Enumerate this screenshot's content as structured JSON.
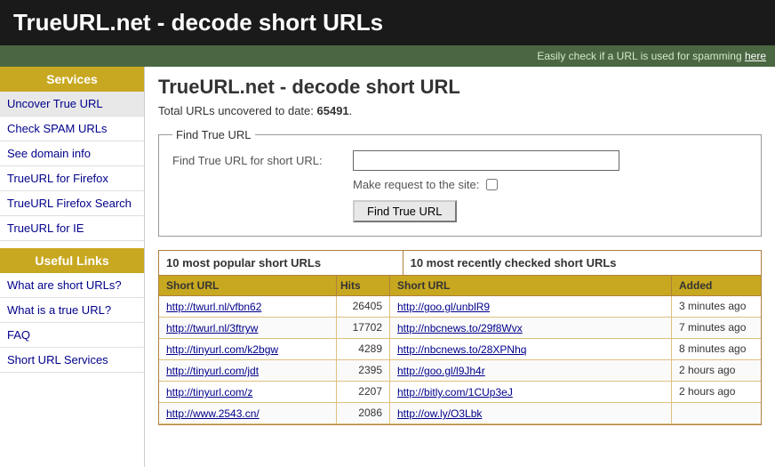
{
  "header": {
    "title": "TrueURL.net - decode short URLs"
  },
  "spam_bar": {
    "text": "Easily check if a URL is used for spamming ",
    "link_text": "here"
  },
  "sidebar": {
    "services_label": "Services",
    "useful_links_label": "Useful Links",
    "service_items": [
      {
        "id": "uncover-true-url",
        "label": "Uncover True URL",
        "active": true
      },
      {
        "id": "check-spam-urls",
        "label": "Check SPAM URLs",
        "active": false
      },
      {
        "id": "see-domain-info",
        "label": "See domain info",
        "active": false
      },
      {
        "id": "trueurl-for-firefox",
        "label": "TrueURL for Firefox",
        "active": false
      },
      {
        "id": "trueurl-firefox-search",
        "label": "TrueURL Firefox Search",
        "active": false
      },
      {
        "id": "trueurl-for-ie",
        "label": "TrueURL for IE",
        "active": false
      }
    ],
    "useful_items": [
      {
        "id": "what-are-short-urls",
        "label": "What are short URLs?"
      },
      {
        "id": "what-is-true-url",
        "label": "What is a true URL?"
      },
      {
        "id": "faq",
        "label": "FAQ"
      },
      {
        "id": "short-url-services",
        "label": "Short URL Services"
      }
    ]
  },
  "main": {
    "page_title": "TrueURL.net - decode short URL",
    "total_count_prefix": "Total URLs uncovered to date: ",
    "total_count": "65491",
    "total_count_suffix": ".",
    "find_box": {
      "legend": "Find True URL",
      "url_label": "Find True URL for short URL:",
      "url_placeholder": "",
      "make_request_label": "Make request to the site:",
      "button_label": "Find True URL"
    },
    "popular_table": {
      "left_header": "10 most popular short URLs",
      "right_header": "10 most recently checked short URLs",
      "col_short_url": "Short URL",
      "col_hits": "Hits",
      "col_short_url_right": "Short URL",
      "col_added": "Added",
      "rows": [
        {
          "left_url": "http://twurl.nl/vfbn62",
          "hits": "26405",
          "right_url": "http://goo.gl/unblR9",
          "added": "3 minutes ago"
        },
        {
          "left_url": "http://twurl.nl/3ftryw",
          "hits": "17702",
          "right_url": "http://nbcnews.to/29f8Wvx",
          "added": "7 minutes ago"
        },
        {
          "left_url": "http://tinyurl.com/k2bgw",
          "hits": "4289",
          "right_url": "http://nbcnews.to/28XPNhq",
          "added": "8 minutes ago"
        },
        {
          "left_url": "http://tinyurl.com/jdt",
          "hits": "2395",
          "right_url": "http://goo.gl/l9Jh4r",
          "added": "2 hours ago"
        },
        {
          "left_url": "http://tinyurl.com/z",
          "hits": "2207",
          "right_url": "http://bitly.com/1CUp3eJ",
          "added": "2 hours ago"
        },
        {
          "left_url": "http://www.2543.cn/",
          "hits": "2086",
          "right_url": "http://ow.ly/O3Lbk",
          "added": ""
        }
      ]
    }
  }
}
